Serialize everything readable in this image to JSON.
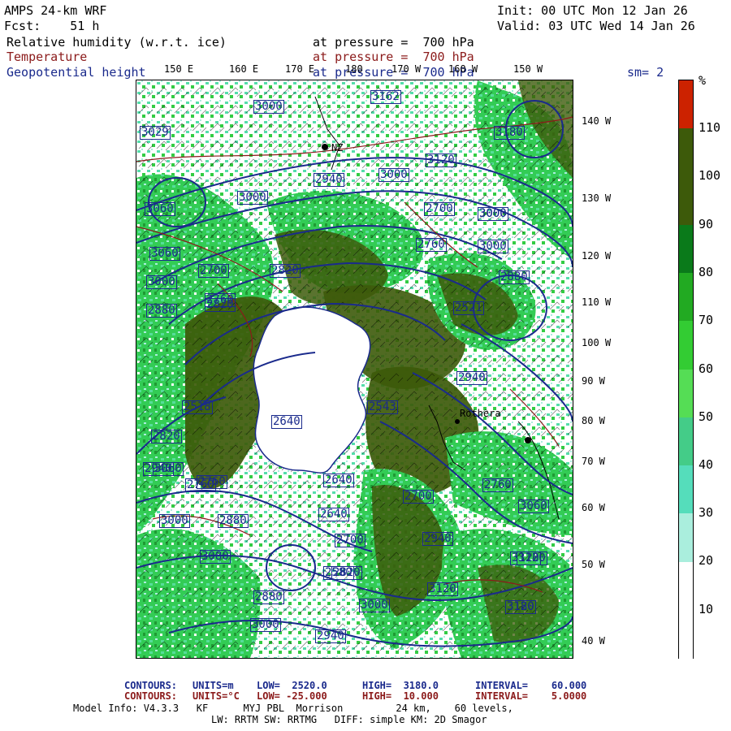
{
  "header": {
    "model": "AMPS 24-km WRF",
    "fcst": "Fcst:    51 h",
    "init": "Init: 00 UTC Mon 12 Jan 26",
    "valid": "Valid: 03 UTC Wed 14 Jan 26",
    "rh_label": "Relative humidity (w.r.t. ice)",
    "rh_level": "at pressure =  700 hPa",
    "temp_label": "Temperature",
    "temp_level": "at pressure =  700 hPa",
    "geo_label": "Geopotential height",
    "geo_level": "at pressure =  700 hPa",
    "sm": "sm= 2"
  },
  "top_lon_labels": [
    "150 E",
    "160 E",
    "170 E",
    "180",
    "170 W",
    "160 W",
    "150 W"
  ],
  "right_lon_labels": [
    "140 W",
    "130 W",
    "120 W",
    "110 W",
    "100 W",
    "90 W",
    "80 W",
    "70 W",
    "60 W",
    "50 W",
    "40 W"
  ],
  "contour_labels": [
    "3162",
    "3000",
    "3029",
    "2940",
    "3000",
    "3060",
    "3000",
    "2880",
    "2640",
    "2700",
    "2760",
    "2820",
    "2518",
    "2640",
    "2760",
    "2820",
    "2880",
    "2940",
    "3000",
    "3060",
    "3120",
    "3180",
    "3000",
    "3080",
    "2820",
    "2580",
    "2700",
    "3060",
    "3120",
    "2760",
    "2640",
    "2880",
    "2820",
    "2700",
    "2940",
    "3000",
    "2760",
    "3120",
    "3180",
    "3000",
    "3120",
    "3000",
    "3120",
    "3060",
    "3000",
    "2543",
    "2521",
    "2760",
    "2880",
    "2700",
    "2940",
    "3000",
    "2940"
  ],
  "place_labels": [
    "NZ",
    "Rothera"
  ],
  "colorbar": {
    "unit": "%",
    "ticks": [
      "110",
      "100",
      "90",
      "80",
      "70",
      "60",
      "50",
      "40",
      "30",
      "20",
      "10"
    ],
    "colors": [
      "#cc2200",
      "#3d5a0a",
      "#3d5a0a",
      "#0a7a1a",
      "#22aa22",
      "#33cc33",
      "#55dd55",
      "#44cc88",
      "#55ddbb",
      "#aaeedd",
      "#ffffff",
      "#ffffff"
    ]
  },
  "footer": {
    "c1_label": "CONTOURS:",
    "c1_units": "UNITS=m",
    "c1_low": "LOW=  2520.0",
    "c1_high": "HIGH=  3180.0",
    "c1_interval": "INTERVAL=    60.000",
    "c2_label": "CONTOURS:",
    "c2_units": "UNITS=°C",
    "c2_low": "LOW= -25.000",
    "c2_high": "HIGH=  10.000",
    "c2_interval": "INTERVAL=    5.0000",
    "model_info": "Model Info: V4.3.3   KF      MYJ PBL  Morrison         24 km,    60 levels,",
    "model_info2": "LW: RRTM SW: RRTMG   DIFF: simple KM: 2D Smagor"
  }
}
